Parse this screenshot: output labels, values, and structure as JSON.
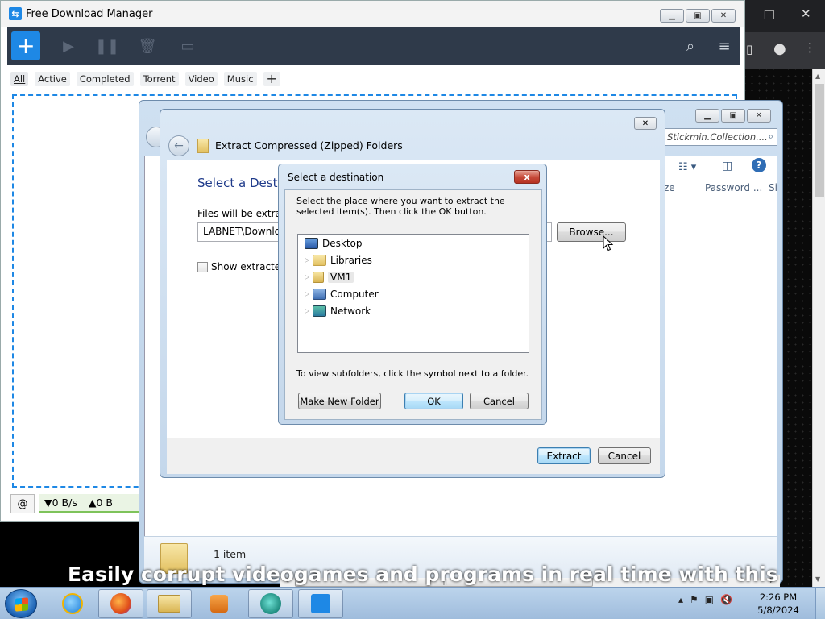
{
  "fdm": {
    "title": "Free Download Manager",
    "tabs": [
      "All",
      "Active",
      "Completed",
      "Torrent",
      "Video",
      "Music"
    ],
    "add_tab": "+",
    "status": {
      "down_speed": "▼0 B/s",
      "up_speed": "▲0 B"
    }
  },
  "explorer": {
    "search_text": "Stickmin.Collection....",
    "columns": {
      "size": "ze",
      "password": "Password ...",
      "extra": "Si"
    },
    "item_count": "1 item"
  },
  "wizard": {
    "title": "Extract Compressed (Zipped) Folders",
    "heading": "Select a Destin",
    "files_label": "Files will be extracte",
    "path": "LABNET\\Downloa",
    "browse_label": "Browse...",
    "show_label": "Show extracted f",
    "extract_label": "Extract",
    "cancel_label": "Cancel"
  },
  "dest_dialog": {
    "title": "Select a destination",
    "close_label": "x",
    "instructions": "Select the place where you want to extract the selected item(s).  Then click the OK button.",
    "tree": [
      {
        "label": "Desktop",
        "icon": "desktop-icon",
        "expandable": false
      },
      {
        "label": "Libraries",
        "icon": "libraries-icon",
        "expandable": true
      },
      {
        "label": "VM1",
        "icon": "user-folder-icon",
        "expandable": true,
        "selected": true
      },
      {
        "label": "Computer",
        "icon": "computer-icon",
        "expandable": true
      },
      {
        "label": "Network",
        "icon": "network-icon",
        "expandable": true
      }
    ],
    "hint": "To view subfolders, click the symbol next to a folder.",
    "make_folder_label": "Make New Folder",
    "ok_label": "OK",
    "cancel_label": "Cancel"
  },
  "caption": "Easily corrupt videogames and programs in real time with this",
  "taskbar": {
    "time": "2:26 PM",
    "date": "5/8/2024"
  }
}
